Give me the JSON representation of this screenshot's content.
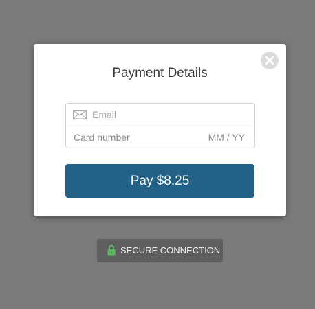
{
  "modal": {
    "title": "Payment Details"
  },
  "form": {
    "email_placeholder": "Email",
    "card_number_placeholder": "Card number",
    "expiry_placeholder": "MM / YY"
  },
  "pay_button": {
    "label": "Pay $8.25"
  },
  "secure_badge": {
    "label": "SECURE CONNECTION"
  },
  "icons": {
    "close": "close-icon",
    "email": "envelope-icon",
    "lock": "lock-icon"
  },
  "colors": {
    "backdrop": "#7b7b7b",
    "pay_button": "#246187",
    "lock": "#5cb85c",
    "badge": "#5f5f5f"
  }
}
